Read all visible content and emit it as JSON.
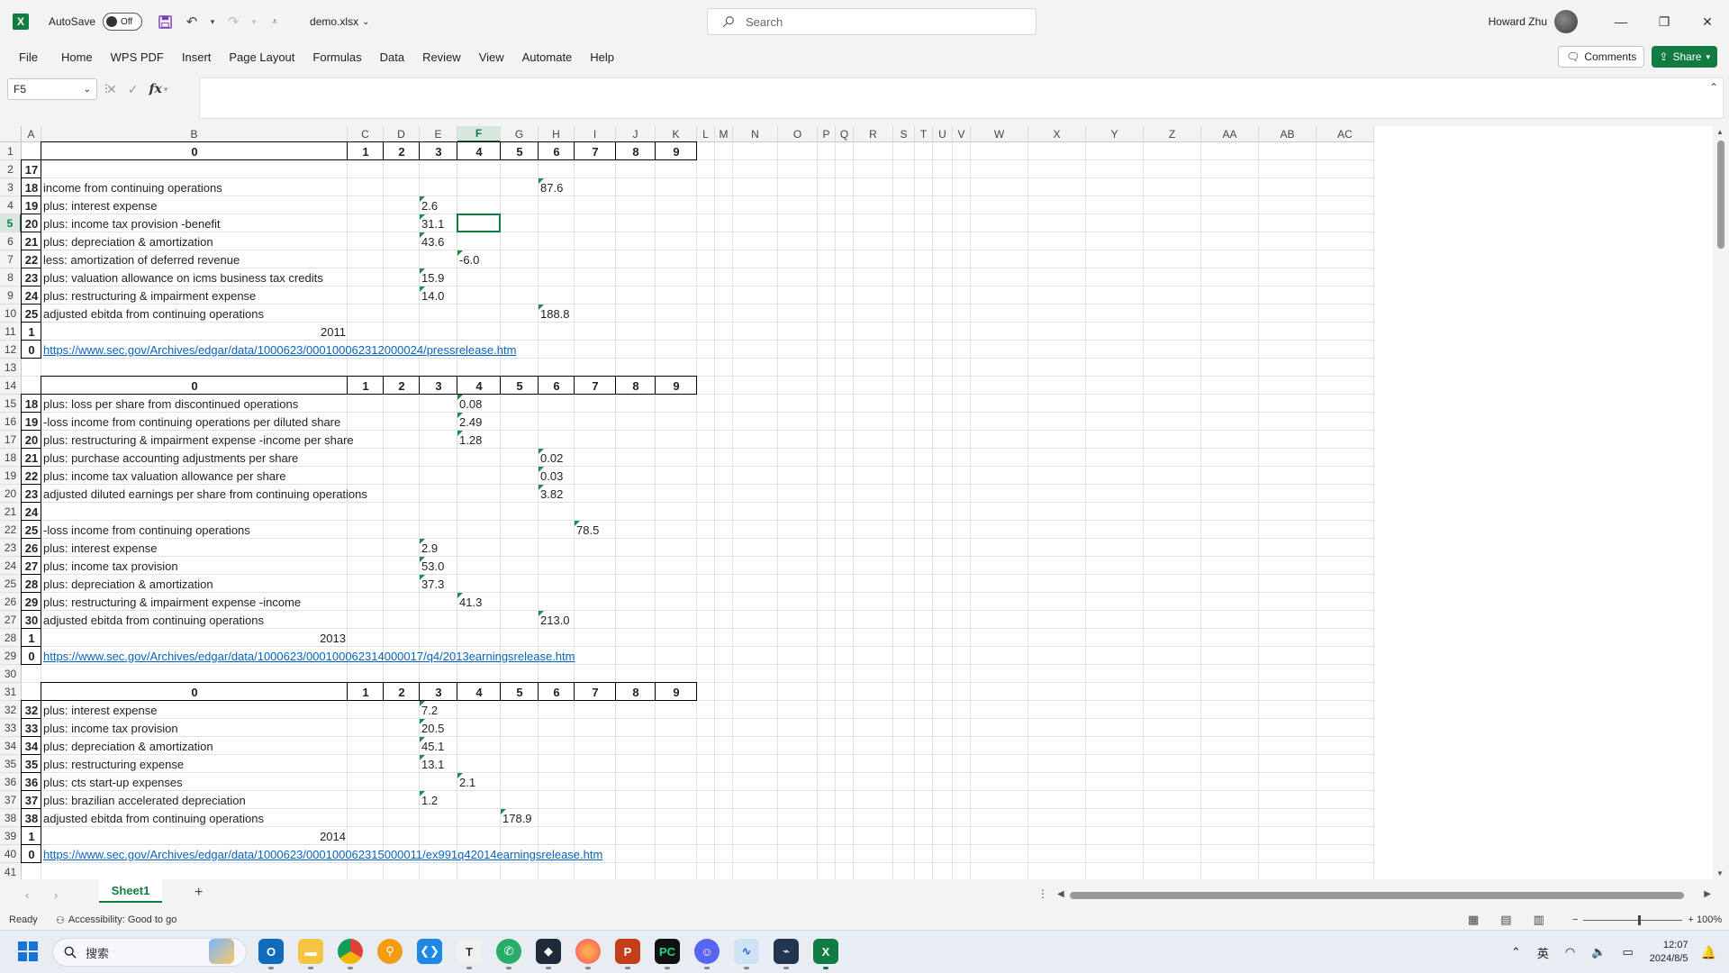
{
  "titlebar": {
    "app_logo": "X",
    "autosave_label": "AutoSave",
    "autosave_state": "Off",
    "filename": "demo.xlsx",
    "search_placeholder": "Search",
    "user_name": "Howard Zhu"
  },
  "menu": {
    "items": [
      "File",
      "Home",
      "WPS PDF",
      "Insert",
      "Page Layout",
      "Formulas",
      "Data",
      "Review",
      "View",
      "Automate",
      "Help"
    ],
    "comments_label": "Comments",
    "share_label": "Share"
  },
  "formula_bar": {
    "name_box": "F5",
    "fx_label": "fx",
    "formula": ""
  },
  "grid": {
    "columns": [
      "A",
      "B",
      "C",
      "D",
      "E",
      "F",
      "G",
      "H",
      "I",
      "J",
      "K",
      "L",
      "M",
      "N",
      "O",
      "P",
      "Q",
      "R",
      "S",
      "T",
      "U",
      "V",
      "W",
      "X",
      "Y",
      "Z",
      "AA",
      "AB",
      "AC"
    ],
    "active_column": "F",
    "active_row": 5,
    "row_numbers": [
      1,
      2,
      3,
      4,
      5,
      6,
      7,
      8,
      9,
      10,
      11,
      12,
      13,
      14,
      15,
      16,
      17,
      18,
      19,
      20,
      21,
      22,
      23,
      24,
      25,
      26,
      27,
      28,
      29,
      30,
      31,
      32,
      33,
      34,
      35,
      36,
      37,
      38,
      39,
      40,
      41
    ],
    "cells": [
      {
        "r": 1,
        "c": "B",
        "v": "0",
        "s": "bc"
      },
      {
        "r": 1,
        "c": "C",
        "v": "1",
        "s": "bc"
      },
      {
        "r": 1,
        "c": "D",
        "v": "2",
        "s": "bc"
      },
      {
        "r": 1,
        "c": "E",
        "v": "3",
        "s": "bc"
      },
      {
        "r": 1,
        "c": "F",
        "v": "4",
        "s": "bc"
      },
      {
        "r": 1,
        "c": "G",
        "v": "5",
        "s": "bc"
      },
      {
        "r": 1,
        "c": "H",
        "v": "6",
        "s": "bc"
      },
      {
        "r": 1,
        "c": "I",
        "v": "7",
        "s": "bc"
      },
      {
        "r": 1,
        "c": "J",
        "v": "8",
        "s": "bc"
      },
      {
        "r": 1,
        "c": "K",
        "v": "9",
        "s": "bc"
      },
      {
        "r": 2,
        "c": "A",
        "v": "17",
        "s": "b"
      },
      {
        "r": 3,
        "c": "A",
        "v": "18",
        "s": "b"
      },
      {
        "r": 3,
        "c": "B",
        "v": "income from continuing operations"
      },
      {
        "r": 3,
        "c": "H",
        "v": "87.6",
        "t": 1
      },
      {
        "r": 4,
        "c": "A",
        "v": "19",
        "s": "b"
      },
      {
        "r": 4,
        "c": "B",
        "v": "plus: interest expense"
      },
      {
        "r": 4,
        "c": "E",
        "v": "2.6",
        "t": 1
      },
      {
        "r": 5,
        "c": "A",
        "v": "20",
        "s": "b"
      },
      {
        "r": 5,
        "c": "B",
        "v": "plus: income tax provision -benefit"
      },
      {
        "r": 5,
        "c": "E",
        "v": "31.1",
        "t": 1
      },
      {
        "r": 6,
        "c": "A",
        "v": "21",
        "s": "b"
      },
      {
        "r": 6,
        "c": "B",
        "v": "plus: depreciation & amortization"
      },
      {
        "r": 6,
        "c": "E",
        "v": "43.6",
        "t": 1
      },
      {
        "r": 7,
        "c": "A",
        "v": "22",
        "s": "b"
      },
      {
        "r": 7,
        "c": "B",
        "v": "less: amortization of deferred revenue"
      },
      {
        "r": 7,
        "c": "F",
        "v": "-6.0",
        "t": 1
      },
      {
        "r": 8,
        "c": "A",
        "v": "23",
        "s": "b"
      },
      {
        "r": 8,
        "c": "B",
        "v": "plus: valuation allowance on icms business tax credits"
      },
      {
        "r": 8,
        "c": "E",
        "v": "15.9",
        "t": 1
      },
      {
        "r": 9,
        "c": "A",
        "v": "24",
        "s": "b"
      },
      {
        "r": 9,
        "c": "B",
        "v": "plus: restructuring & impairment expense"
      },
      {
        "r": 9,
        "c": "E",
        "v": "14.0",
        "t": 1
      },
      {
        "r": 10,
        "c": "A",
        "v": "25",
        "s": "b"
      },
      {
        "r": 10,
        "c": "B",
        "v": "adjusted ebitda from continuing operations"
      },
      {
        "r": 10,
        "c": "H",
        "v": "188.8",
        "t": 1
      },
      {
        "r": 11,
        "c": "A",
        "v": "1",
        "s": "b"
      },
      {
        "r": 11,
        "c": "B",
        "v": "2011",
        "s": "r"
      },
      {
        "r": 12,
        "c": "A",
        "v": "0",
        "s": "b"
      },
      {
        "r": 12,
        "c": "B",
        "v": "https://www.sec.gov/Archives/edgar/data/1000623/000100062312000024/pressrelease.htm",
        "s": "l"
      },
      {
        "r": 14,
        "c": "B",
        "v": "0",
        "s": "bc"
      },
      {
        "r": 14,
        "c": "C",
        "v": "1",
        "s": "bc"
      },
      {
        "r": 14,
        "c": "D",
        "v": "2",
        "s": "bc"
      },
      {
        "r": 14,
        "c": "E",
        "v": "3",
        "s": "bc"
      },
      {
        "r": 14,
        "c": "F",
        "v": "4",
        "s": "bc"
      },
      {
        "r": 14,
        "c": "G",
        "v": "5",
        "s": "bc"
      },
      {
        "r": 14,
        "c": "H",
        "v": "6",
        "s": "bc"
      },
      {
        "r": 14,
        "c": "I",
        "v": "7",
        "s": "bc"
      },
      {
        "r": 14,
        "c": "J",
        "v": "8",
        "s": "bc"
      },
      {
        "r": 14,
        "c": "K",
        "v": "9",
        "s": "bc"
      },
      {
        "r": 15,
        "c": "A",
        "v": "18",
        "s": "b"
      },
      {
        "r": 15,
        "c": "B",
        "v": "plus: loss per share from discontinued operations"
      },
      {
        "r": 15,
        "c": "F",
        "v": "0.08",
        "t": 1
      },
      {
        "r": 16,
        "c": "A",
        "v": "19",
        "s": "b"
      },
      {
        "r": 16,
        "c": "B",
        "v": "-loss income from continuing operations per diluted share"
      },
      {
        "r": 16,
        "c": "F",
        "v": "2.49",
        "t": 1
      },
      {
        "r": 17,
        "c": "A",
        "v": "20",
        "s": "b"
      },
      {
        "r": 17,
        "c": "B",
        "v": "plus: restructuring & impairment expense -income per share"
      },
      {
        "r": 17,
        "c": "F",
        "v": "1.28",
        "t": 1
      },
      {
        "r": 18,
        "c": "A",
        "v": "21",
        "s": "b"
      },
      {
        "r": 18,
        "c": "B",
        "v": "plus: purchase accounting adjustments per share"
      },
      {
        "r": 18,
        "c": "H",
        "v": "0.02",
        "t": 1
      },
      {
        "r": 19,
        "c": "A",
        "v": "22",
        "s": "b"
      },
      {
        "r": 19,
        "c": "B",
        "v": "plus: income tax valuation allowance per share"
      },
      {
        "r": 19,
        "c": "H",
        "v": "0.03",
        "t": 1
      },
      {
        "r": 20,
        "c": "A",
        "v": "23",
        "s": "b"
      },
      {
        "r": 20,
        "c": "B",
        "v": "adjusted diluted earnings per share from continuing operations"
      },
      {
        "r": 20,
        "c": "H",
        "v": "3.82",
        "t": 1
      },
      {
        "r": 21,
        "c": "A",
        "v": "24",
        "s": "b"
      },
      {
        "r": 22,
        "c": "A",
        "v": "25",
        "s": "b"
      },
      {
        "r": 22,
        "c": "B",
        "v": "-loss income from continuing operations"
      },
      {
        "r": 22,
        "c": "I",
        "v": "78.5",
        "t": 1
      },
      {
        "r": 23,
        "c": "A",
        "v": "26",
        "s": "b"
      },
      {
        "r": 23,
        "c": "B",
        "v": "plus: interest expense"
      },
      {
        "r": 23,
        "c": "E",
        "v": "2.9",
        "t": 1
      },
      {
        "r": 24,
        "c": "A",
        "v": "27",
        "s": "b"
      },
      {
        "r": 24,
        "c": "B",
        "v": "plus: income tax provision"
      },
      {
        "r": 24,
        "c": "E",
        "v": "53.0",
        "t": 1
      },
      {
        "r": 25,
        "c": "A",
        "v": "28",
        "s": "b"
      },
      {
        "r": 25,
        "c": "B",
        "v": "plus: depreciation & amortization"
      },
      {
        "r": 25,
        "c": "E",
        "v": "37.3",
        "t": 1
      },
      {
        "r": 26,
        "c": "A",
        "v": "29",
        "s": "b"
      },
      {
        "r": 26,
        "c": "B",
        "v": "plus: restructuring & impairment expense -income"
      },
      {
        "r": 26,
        "c": "F",
        "v": "41.3",
        "t": 1
      },
      {
        "r": 27,
        "c": "A",
        "v": "30",
        "s": "b"
      },
      {
        "r": 27,
        "c": "B",
        "v": "adjusted ebitda from continuing operations"
      },
      {
        "r": 27,
        "c": "H",
        "v": "213.0",
        "t": 1
      },
      {
        "r": 28,
        "c": "A",
        "v": "1",
        "s": "b"
      },
      {
        "r": 28,
        "c": "B",
        "v": "2013",
        "s": "r"
      },
      {
        "r": 29,
        "c": "A",
        "v": "0",
        "s": "b"
      },
      {
        "r": 29,
        "c": "B",
        "v": "https://www.sec.gov/Archives/edgar/data/1000623/000100062314000017/q4/2013earningsrelease.htm",
        "s": "l"
      },
      {
        "r": 31,
        "c": "B",
        "v": "0",
        "s": "bc"
      },
      {
        "r": 31,
        "c": "C",
        "v": "1",
        "s": "bc"
      },
      {
        "r": 31,
        "c": "D",
        "v": "2",
        "s": "bc"
      },
      {
        "r": 31,
        "c": "E",
        "v": "3",
        "s": "bc"
      },
      {
        "r": 31,
        "c": "F",
        "v": "4",
        "s": "bc"
      },
      {
        "r": 31,
        "c": "G",
        "v": "5",
        "s": "bc"
      },
      {
        "r": 31,
        "c": "H",
        "v": "6",
        "s": "bc"
      },
      {
        "r": 31,
        "c": "I",
        "v": "7",
        "s": "bc"
      },
      {
        "r": 31,
        "c": "J",
        "v": "8",
        "s": "bc"
      },
      {
        "r": 31,
        "c": "K",
        "v": "9",
        "s": "bc"
      },
      {
        "r": 32,
        "c": "A",
        "v": "32",
        "s": "b"
      },
      {
        "r": 32,
        "c": "B",
        "v": "plus: interest expense"
      },
      {
        "r": 32,
        "c": "E",
        "v": "7.2",
        "t": 1
      },
      {
        "r": 33,
        "c": "A",
        "v": "33",
        "s": "b"
      },
      {
        "r": 33,
        "c": "B",
        "v": "plus: income tax provision"
      },
      {
        "r": 33,
        "c": "E",
        "v": "20.5",
        "t": 1
      },
      {
        "r": 34,
        "c": "A",
        "v": "34",
        "s": "b"
      },
      {
        "r": 34,
        "c": "B",
        "v": "plus: depreciation & amortization"
      },
      {
        "r": 34,
        "c": "E",
        "v": "45.1",
        "t": 1
      },
      {
        "r": 35,
        "c": "A",
        "v": "35",
        "s": "b"
      },
      {
        "r": 35,
        "c": "B",
        "v": "plus: restructuring expense"
      },
      {
        "r": 35,
        "c": "E",
        "v": "13.1",
        "t": 1
      },
      {
        "r": 36,
        "c": "A",
        "v": "36",
        "s": "b"
      },
      {
        "r": 36,
        "c": "B",
        "v": "plus: cts start-up expenses"
      },
      {
        "r": 36,
        "c": "F",
        "v": "2.1",
        "t": 1
      },
      {
        "r": 37,
        "c": "A",
        "v": "37",
        "s": "b"
      },
      {
        "r": 37,
        "c": "B",
        "v": "plus: brazilian accelerated depreciation"
      },
      {
        "r": 37,
        "c": "E",
        "v": "1.2",
        "t": 1
      },
      {
        "r": 38,
        "c": "A",
        "v": "38",
        "s": "b"
      },
      {
        "r": 38,
        "c": "B",
        "v": "adjusted ebitda from continuing operations"
      },
      {
        "r": 38,
        "c": "G",
        "v": "178.9",
        "t": 1
      },
      {
        "r": 39,
        "c": "A",
        "v": "1",
        "s": "b"
      },
      {
        "r": 39,
        "c": "B",
        "v": "2014",
        "s": "r"
      },
      {
        "r": 40,
        "c": "A",
        "v": "0",
        "s": "b"
      },
      {
        "r": 40,
        "c": "B",
        "v": "https://www.sec.gov/Archives/edgar/data/1000623/000100062315000011/ex991q42014earningsrelease.htm",
        "s": "l"
      }
    ]
  },
  "sheets": {
    "tabs": [
      "Sheet1"
    ],
    "add_label": "+"
  },
  "status": {
    "ready": "Ready",
    "accessibility": "Accessibility: Good to go",
    "zoom_minus": "−",
    "zoom_plus": "+",
    "zoom": "100%"
  },
  "taskbar": {
    "search_placeholder": "搜索",
    "lang": "英",
    "time": "12:07",
    "date": "2024/8/5"
  }
}
